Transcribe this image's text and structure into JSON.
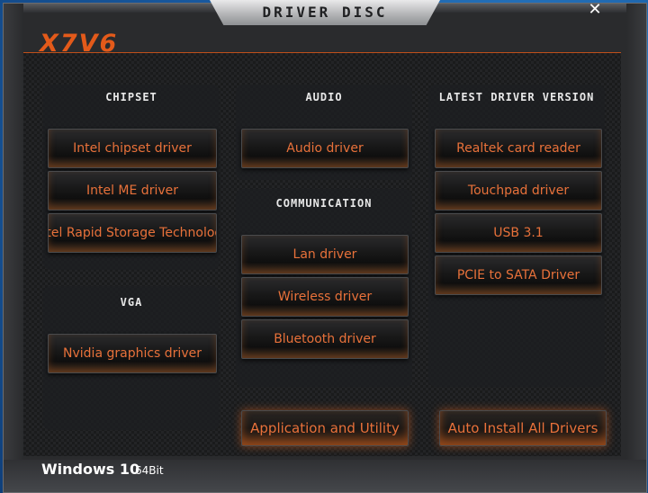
{
  "window": {
    "title": "DRIVER DISC",
    "close_glyph": "✕",
    "logo": "X7V6"
  },
  "chipset": {
    "title": "CHIPSET",
    "buttons": [
      "Intel chipset driver",
      "Intel ME driver",
      "Intel Rapid Storage Technology"
    ]
  },
  "vga": {
    "title": "VGA",
    "buttons": [
      "Nvidia graphics driver"
    ]
  },
  "audio": {
    "title": "AUDIO",
    "buttons": [
      "Audio driver"
    ]
  },
  "communication": {
    "title": "COMMUNICATION",
    "buttons": [
      "Lan driver",
      "Wireless driver",
      "Bluetooth driver"
    ]
  },
  "latest": {
    "title": "LATEST DRIVER VERSION",
    "buttons": [
      "Realtek card reader",
      "Touchpad driver",
      "USB 3.1",
      "PCIE to SATA  Driver"
    ]
  },
  "actions": {
    "app_utility": "Application and Utility",
    "auto_install": "Auto Install All Drivers"
  },
  "footer": {
    "os": "Windows 10",
    "bits": "64Bit"
  },
  "colors": {
    "accent": "#e35a1a",
    "button_text": "#e8713a",
    "background": "#1a1b1c"
  }
}
